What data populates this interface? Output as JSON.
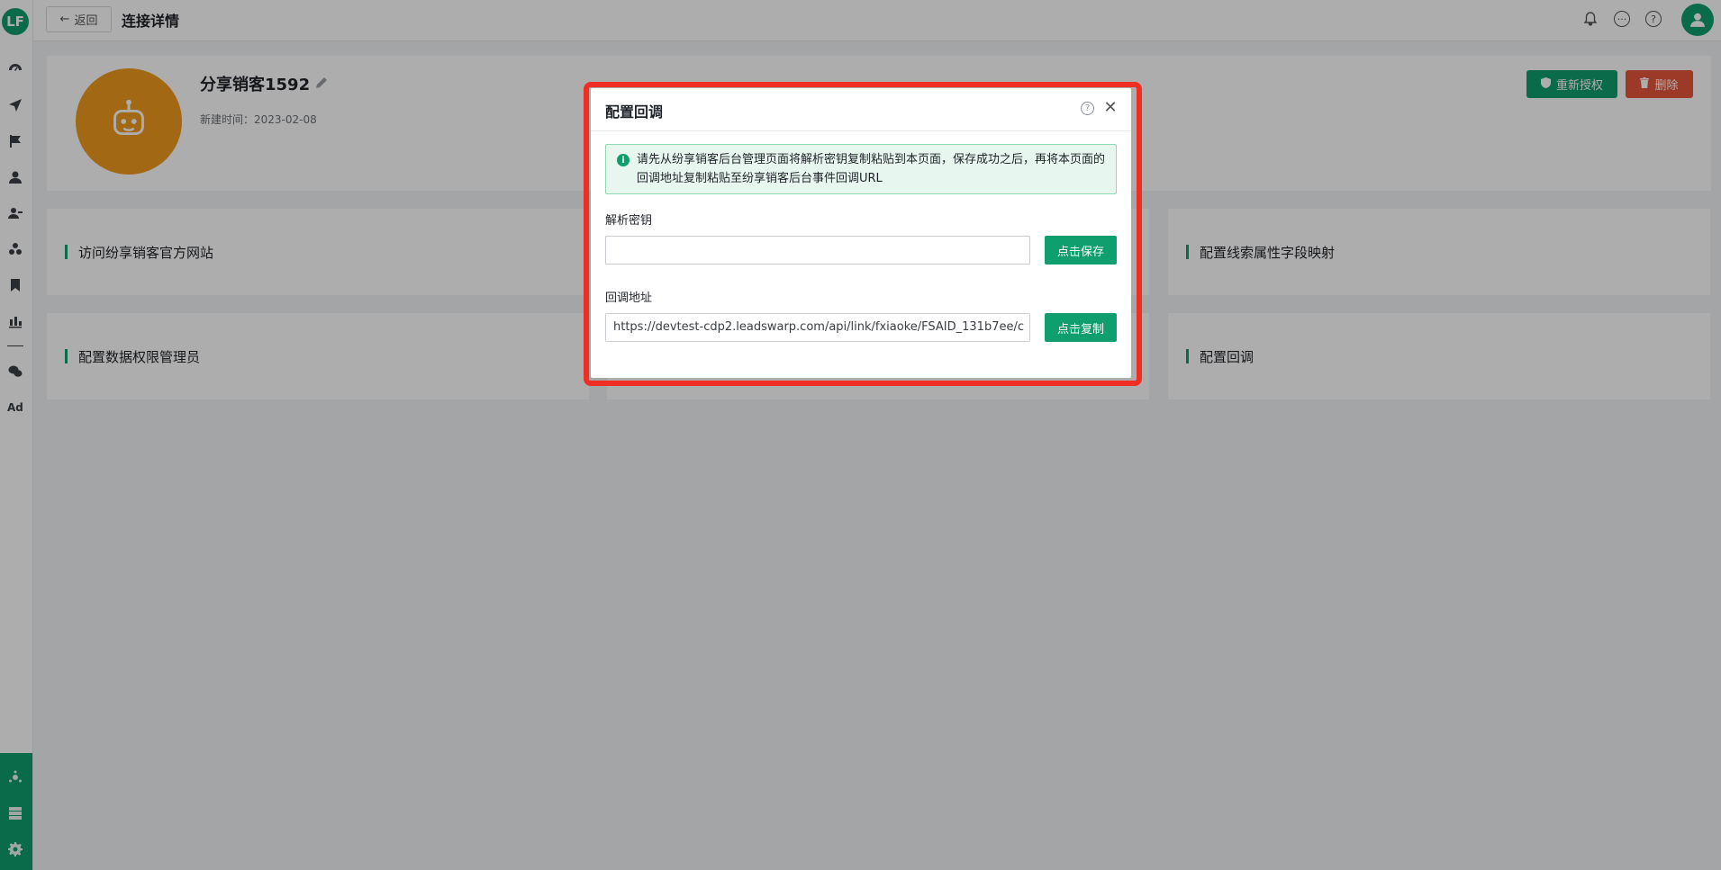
{
  "header": {
    "back_label": "返回",
    "title": "连接详情"
  },
  "sidebar": {
    "logo_text": "LF",
    "items": [
      "dashboard-icon",
      "send-icon",
      "flag-icon",
      "user-icon",
      "users-icon",
      "group-icon",
      "bookmark-icon",
      "chart-icon",
      "wechat-icon"
    ],
    "ad_label": "Ad"
  },
  "profile": {
    "name": "分享销客1592",
    "created_label": "新建时间：",
    "created_date": "2023-02-08",
    "reauth_label": "重新授权",
    "delete_label": "删除"
  },
  "cards": [
    {
      "label": "访问纷享销客官方网站"
    },
    {
      "label": "配置线索属性字段映射"
    },
    {
      "label": "配置数据权限管理员"
    },
    {
      "label": "配置回调"
    }
  ],
  "modal": {
    "title": "配置回调",
    "alert_text": "请先从纷享销客后台管理页面将解析密钥复制粘贴到本页面，保存成功之后，再将本页面的回调地址复制粘贴至纷享销客后台事件回调URL",
    "secret_label": "解析密钥",
    "secret_value": "",
    "save_label": "点击保存",
    "callback_label": "回调地址",
    "callback_value": "https://devtest-cdp2.leadswarp.com/api/link/fxiaoke/FSAID_131b7ee/c",
    "copy_label": "点击复制"
  },
  "colors": {
    "brand": "#0f9e6e",
    "danger": "#e6553a",
    "avatar": "#f09a1e",
    "highlight": "#ef2e24"
  }
}
